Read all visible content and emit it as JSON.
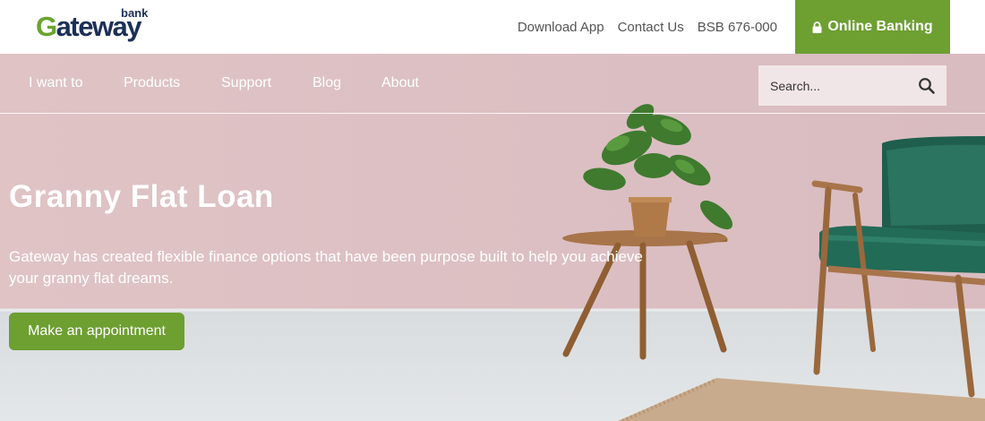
{
  "logo": {
    "name": "Gateway",
    "suffix": "bank"
  },
  "top_links": [
    "Download App",
    "Contact Us",
    "BSB 676-000"
  ],
  "online_banking": {
    "label": "Online Banking",
    "icon": "lock-icon"
  },
  "nav": [
    "I want to",
    "Products",
    "Support",
    "Blog",
    "About"
  ],
  "search": {
    "placeholder": "Search...",
    "icon": "search-icon"
  },
  "hero": {
    "title": "Granny Flat Loan",
    "description": "Gateway has created flexible finance options that have been purpose built to help you achieve your granny flat dreams.",
    "cta": "Make an appointment"
  },
  "colors": {
    "brand_green": "#6d9f31",
    "brand_navy": "#1c2f57",
    "wall_pink": "#dcc1c4"
  }
}
